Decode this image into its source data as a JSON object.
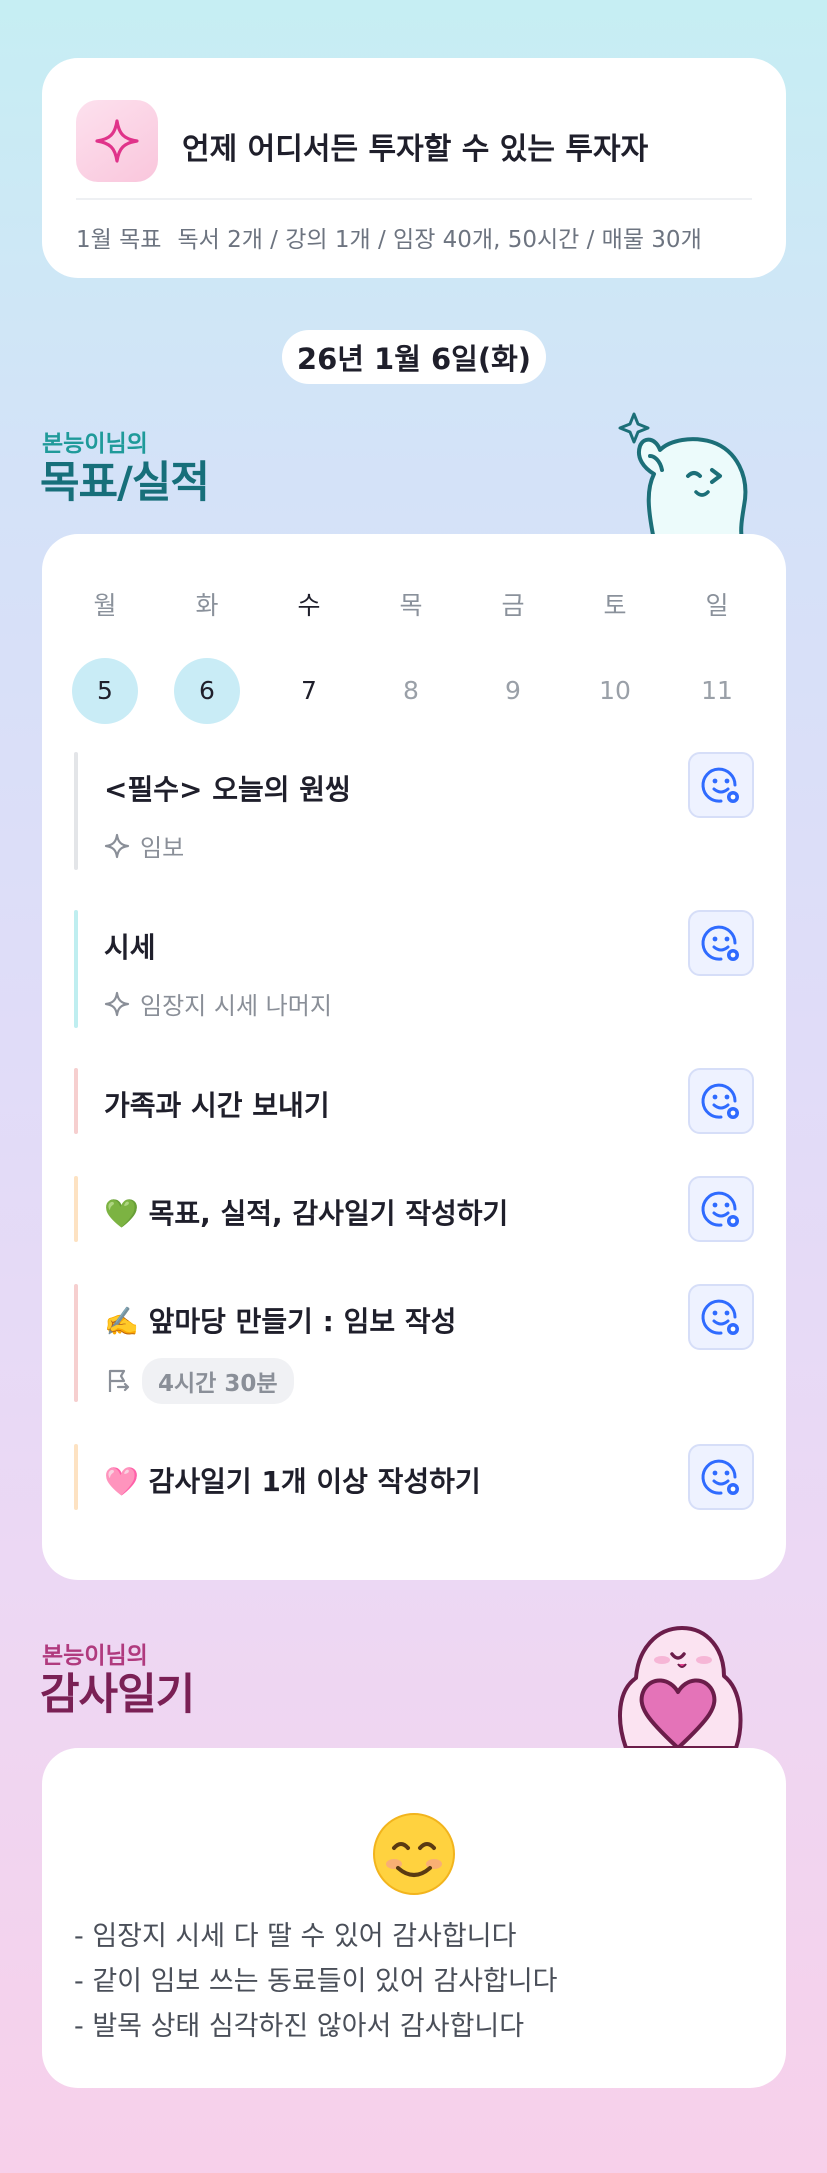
{
  "motto": {
    "icon": "sparkle-icon",
    "text": "언제 어디서든 투자할 수 있는 투자자",
    "goal_label": "1월 목표",
    "goal_text": "독서 2개 / 강의 1개 / 임장 40개, 50시간 / 매물 30개"
  },
  "date_pill": "26년 1월 6일(화)",
  "goals_section": {
    "small_title": "본능이님의",
    "big_title": "목표/실적"
  },
  "week": {
    "days": [
      {
        "name": "월",
        "num": "5",
        "state": "done"
      },
      {
        "name": "화",
        "num": "6",
        "state": "done"
      },
      {
        "name": "수",
        "num": "7",
        "state": "today"
      },
      {
        "name": "목",
        "num": "8",
        "state": "future"
      },
      {
        "name": "금",
        "num": "9",
        "state": "future"
      },
      {
        "name": "토",
        "num": "10",
        "state": "future"
      },
      {
        "name": "일",
        "num": "11",
        "state": "future"
      }
    ]
  },
  "tasks": [
    {
      "title": "<필수> 오늘의 원씽",
      "sub": "임보",
      "sub_icon": "sparkle-outline-icon",
      "bar_color": "#e3e5e8"
    },
    {
      "title": "시세",
      "sub": "임장지 시세 나머지",
      "sub_icon": "sparkle-outline-icon",
      "bar_color": "#bfeef0"
    },
    {
      "title": "가족과 시간 보내기",
      "bar_color": "#f6cfcf"
    },
    {
      "title": "💚 목표, 실적, 감사일기 작성하기",
      "bar_color": "#fde2c2"
    },
    {
      "title": "✍️ 앞마당 만들기 : 임보 작성",
      "duration": "4시간 30분",
      "sub_icon": "flag-return-icon",
      "bar_color": "#f6cfcf"
    },
    {
      "title": "🩷 감사일기 1개 이상 작성하기",
      "bar_color": "#fde2c2"
    }
  ],
  "task_button_icon": "smiley-add-icon",
  "gratitude_section": {
    "small_title": "본능이님의",
    "big_title": "감사일기",
    "emoji": "smiling-face-icon",
    "items": [
      "- 임장지 시세 다 딸 수 있어 감사합니다",
      "- 같이 임보 쓰는 동료들이 있어 감사합니다",
      "- 발목 상태 심각하진 않아서 감사합니다"
    ]
  },
  "colors": {
    "accent_teal": "#176f7a",
    "accent_pink": "#7a2055",
    "button_blue": "#2f6bff"
  }
}
